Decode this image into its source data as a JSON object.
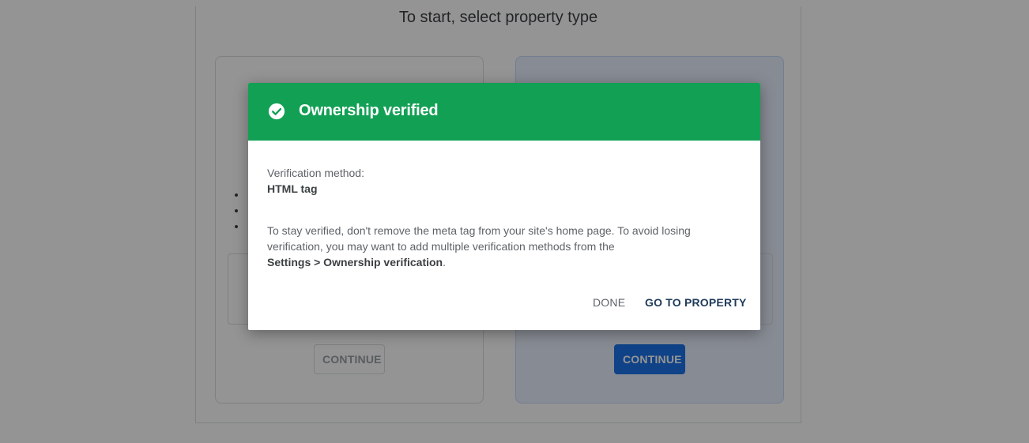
{
  "page": {
    "heading": "To start, select property type",
    "left_card": {
      "continue_label": "CONTINUE"
    },
    "right_card": {
      "continue_label": "CONTINUE"
    }
  },
  "dialog": {
    "title": "Ownership verified",
    "icon": "check-circle-icon",
    "method_label": "Verification method:",
    "method_value": "HTML tag",
    "body_text": "To stay verified, don't remove the meta tag from your site's home page. To avoid losing verification, you may want to add multiple verification methods from the",
    "settings_link_text": "Settings > Ownership verification",
    "settings_suffix": ".",
    "done_label": "DONE",
    "go_to_property_label": "GO TO PROPERTY"
  },
  "colors": {
    "header_green": "#12a054",
    "primary_blue": "#1a73e8"
  }
}
